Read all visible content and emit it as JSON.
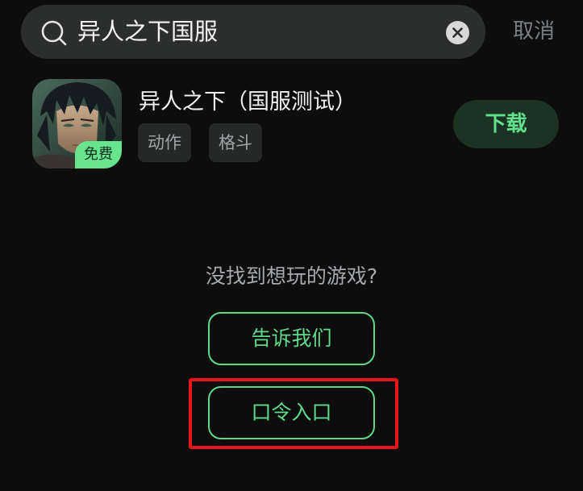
{
  "search": {
    "query": "异人之下国服",
    "icon": "search-icon",
    "clear_icon": "close-icon",
    "cancel_label": "取消"
  },
  "result": {
    "title": "异人之下（国服测试）",
    "badge": "免费",
    "tags": [
      "动作",
      "格斗"
    ],
    "download_label": "下载"
  },
  "empty_state": {
    "prompt": "没找到想玩的游戏?",
    "tell_us_label": "告诉我们",
    "code_entry_label": "口令入口"
  },
  "colors": {
    "accent_green": "#5fd889",
    "highlight_red": "#e8161a",
    "background": "#0c0d0c"
  }
}
